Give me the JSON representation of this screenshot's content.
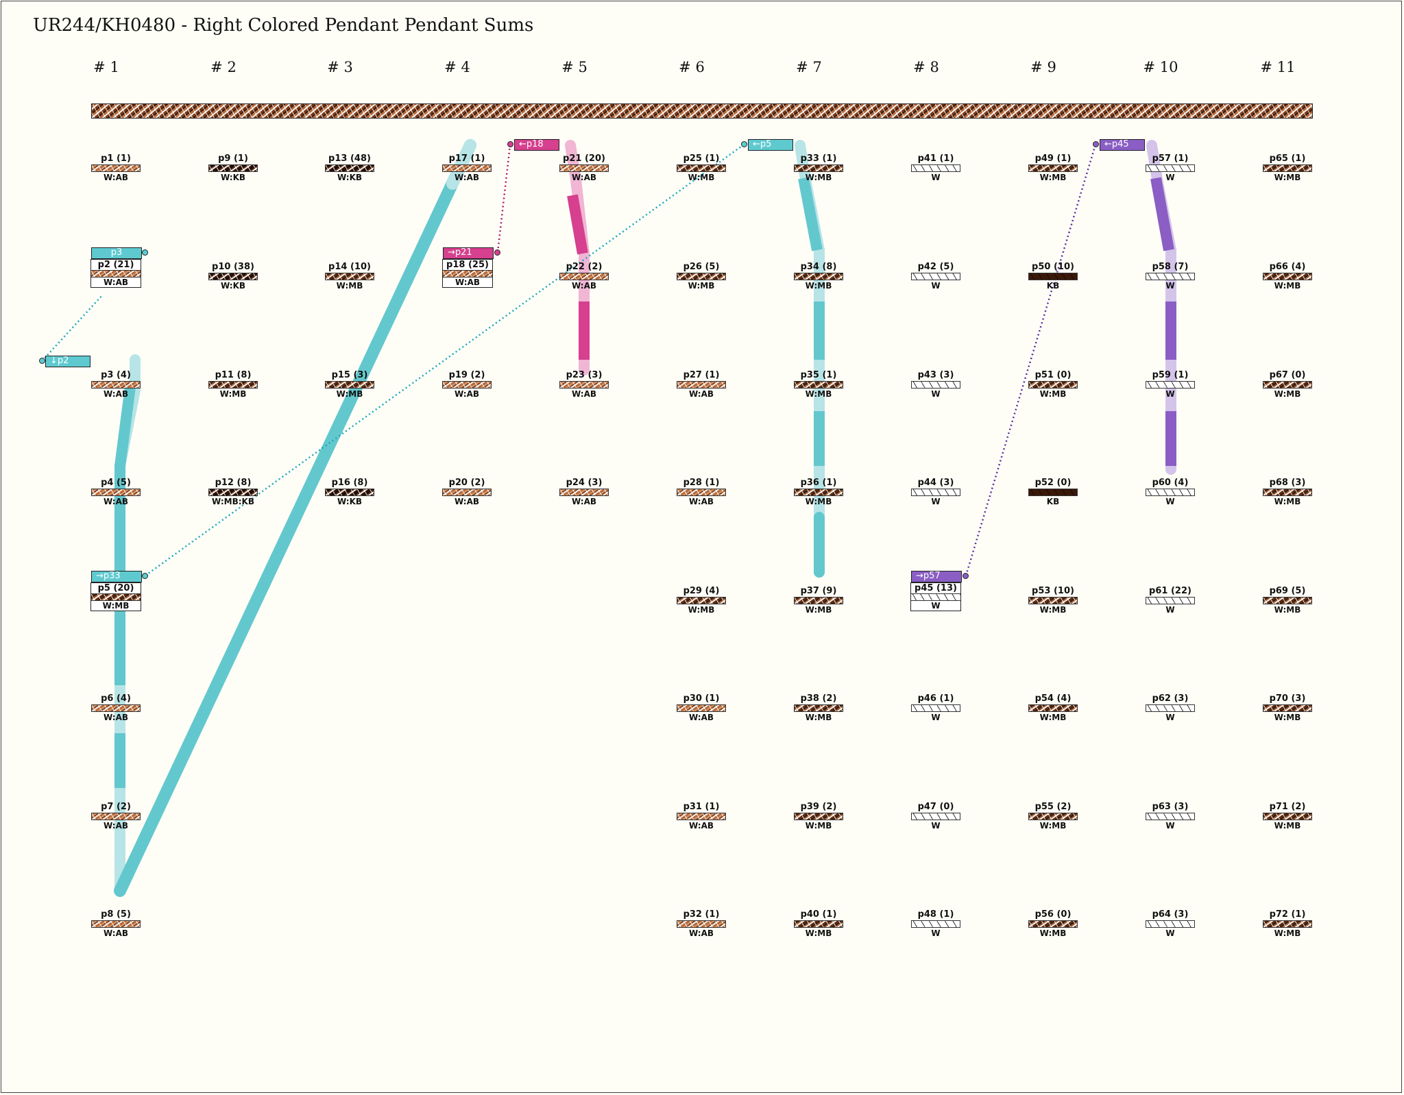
{
  "title": "UR244/KH0480 - Right Colored Pendant Pendant Sums",
  "groups": [
    "# 1",
    "# 2",
    "# 3",
    "# 4",
    "# 5",
    "# 6",
    "# 7",
    "# 8",
    "# 9",
    "# 10",
    "# 11"
  ],
  "pendants": [
    {
      "label": "p1 (1)",
      "color": "W:AB"
    },
    {
      "label": "p2 (21)",
      "color": "W:AB"
    },
    {
      "label": "p3 (4)",
      "color": "W:AB"
    },
    {
      "label": "p4 (5)",
      "color": "W:AB"
    },
    {
      "label": "p5 (20)",
      "color": "W:MB"
    },
    {
      "label": "p6 (4)",
      "color": "W:AB"
    },
    {
      "label": "p7 (2)",
      "color": "W:AB"
    },
    {
      "label": "p8 (5)",
      "color": "W:AB"
    },
    {
      "label": "p9 (1)",
      "color": "W:KB"
    },
    {
      "label": "p10 (38)",
      "color": "W:KB"
    },
    {
      "label": "p11 (8)",
      "color": "W:MB"
    },
    {
      "label": "p12 (8)",
      "color": "W:MB:KB"
    },
    {
      "label": "p13 (48)",
      "color": "W:KB"
    },
    {
      "label": "p14 (10)",
      "color": "W:MB"
    },
    {
      "label": "p15 (3)",
      "color": "W:MB"
    },
    {
      "label": "p16 (8)",
      "color": "W:KB"
    },
    {
      "label": "p17 (1)",
      "color": "W:AB"
    },
    {
      "label": "p18 (25)",
      "color": "W:AB"
    },
    {
      "label": "p19 (2)",
      "color": "W:AB"
    },
    {
      "label": "p20 (2)",
      "color": "W:AB"
    },
    {
      "label": "p21 (20)",
      "color": "W:AB"
    },
    {
      "label": "p22 (2)",
      "color": "W:AB"
    },
    {
      "label": "p23 (3)",
      "color": "W:AB"
    },
    {
      "label": "p24 (3)",
      "color": "W:AB"
    },
    {
      "label": "p25 (1)",
      "color": "W:MB"
    },
    {
      "label": "p26 (5)",
      "color": "W:MB"
    },
    {
      "label": "p27 (1)",
      "color": "W:AB"
    },
    {
      "label": "p28 (1)",
      "color": "W:AB"
    },
    {
      "label": "p29 (4)",
      "color": "W:MB"
    },
    {
      "label": "p30 (1)",
      "color": "W:AB"
    },
    {
      "label": "p31 (1)",
      "color": "W:AB"
    },
    {
      "label": "p32 (1)",
      "color": "W:AB"
    },
    {
      "label": "p33 (1)",
      "color": "W:MB"
    },
    {
      "label": "p34 (8)",
      "color": "W:MB"
    },
    {
      "label": "p35 (1)",
      "color": "W:MB"
    },
    {
      "label": "p36 (1)",
      "color": "W:MB"
    },
    {
      "label": "p37 (9)",
      "color": "W:MB"
    },
    {
      "label": "p38 (2)",
      "color": "W:MB"
    },
    {
      "label": "p39 (2)",
      "color": "W:MB"
    },
    {
      "label": "p40 (1)",
      "color": "W:MB"
    },
    {
      "label": "p41 (1)",
      "color": "W"
    },
    {
      "label": "p42 (5)",
      "color": "W"
    },
    {
      "label": "p43 (3)",
      "color": "W"
    },
    {
      "label": "p44 (3)",
      "color": "W"
    },
    {
      "label": "p45 (13)",
      "color": "W"
    },
    {
      "label": "p46 (1)",
      "color": "W"
    },
    {
      "label": "p47 (0)",
      "color": "W"
    },
    {
      "label": "p48 (1)",
      "color": "W"
    },
    {
      "label": "p49 (1)",
      "color": "W:MB"
    },
    {
      "label": "p50 (10)",
      "color": "KB"
    },
    {
      "label": "p51 (0)",
      "color": "W:MB"
    },
    {
      "label": "p52 (0)",
      "color": "KB"
    },
    {
      "label": "p53 (10)",
      "color": "W:MB"
    },
    {
      "label": "p54 (4)",
      "color": "W:MB"
    },
    {
      "label": "p55 (2)",
      "color": "W:MB"
    },
    {
      "label": "p56 (0)",
      "color": "W:MB"
    },
    {
      "label": "p57 (1)",
      "color": "W"
    },
    {
      "label": "p58 (7)",
      "color": "W"
    },
    {
      "label": "p59 (1)",
      "color": "W"
    },
    {
      "label": "p60 (4)",
      "color": "W"
    },
    {
      "label": "p61 (22)",
      "color": "W"
    },
    {
      "label": "p62 (3)",
      "color": "W"
    },
    {
      "label": "p63 (3)",
      "color": "W"
    },
    {
      "label": "p64 (3)",
      "color": "W"
    },
    {
      "label": "p65 (1)",
      "color": "W:MB"
    },
    {
      "label": "p66 (4)",
      "color": "W:MB"
    },
    {
      "label": "p67 (0)",
      "color": "W:MB"
    },
    {
      "label": "p68 (3)",
      "color": "W:MB"
    },
    {
      "label": "p69 (5)",
      "color": "W:MB"
    },
    {
      "label": "p70 (3)",
      "color": "W:MB"
    },
    {
      "label": "p71 (2)",
      "color": "W:MB"
    },
    {
      "label": "p72 (1)",
      "color": "W:MB"
    }
  ],
  "tags": [
    {
      "label": "p3",
      "color": "#5ecad0"
    },
    {
      "label": "↓p2",
      "color": "#5ecad0"
    },
    {
      "label": "→p33",
      "color": "#5ecad0"
    },
    {
      "label": "→p21",
      "color": "#d6408e"
    },
    {
      "label": "←p18",
      "color": "#d6408e"
    },
    {
      "label": "←p5",
      "color": "#5ecad0"
    },
    {
      "label": "→p57",
      "color": "#8a5ec4"
    },
    {
      "label": "←p45",
      "color": "#8a5ec4"
    }
  ]
}
